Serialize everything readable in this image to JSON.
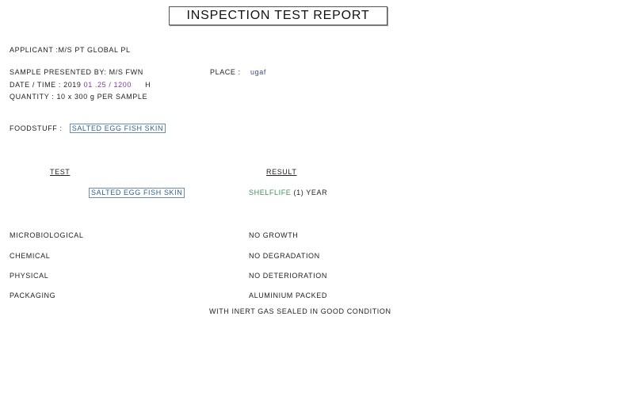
{
  "report": {
    "title": "INSPECTION TEST REPORT",
    "applicant": "APPLICANT :M/S PT GLOBAL PL",
    "sample_presented_by": "SAMPLE PRESENTED BY: M/S FWN",
    "place_label": "PLACE :",
    "place_value": "ugaf",
    "date_time_label": "DATE / TIME :",
    "date_time_value_a": "2019",
    "date_time_value_b": "01 .25 / 1200",
    "date_time_value_c": "H",
    "quantity": "QUANTITY  :  10 x 300  g  PER SAMPLE",
    "foodstuff_label": "FOODSTUFF  :",
    "foodstuff_value": "SALTED EGG FISH SKIN",
    "test_header": "TEST",
    "result_header": "RESULT",
    "test_item": "SALTED EGG FISH SKIN",
    "test_result_a": "SHELFLIFE",
    "test_result_b": "(1) YEAR",
    "rows": [
      {
        "label": "MICROBIOLOGICAL",
        "value": "NO GROWTH"
      },
      {
        "label": "CHEMICAL",
        "value": "NO DEGRADATION"
      },
      {
        "label": "PHYSICAL",
        "value": "NO DETERIORATION"
      },
      {
        "label": "PACKAGING",
        "value": "ALUMINIUM PACKED"
      }
    ],
    "packaging_note": "WITH INERT GAS SEALED  IN GOOD CONDITION"
  },
  "colors": {
    "highlight_box": "#6a8fb0",
    "date_highlight": "#7a3b9a",
    "place_value": "#3a4a8a",
    "shelflife": "#3f8f5a"
  }
}
